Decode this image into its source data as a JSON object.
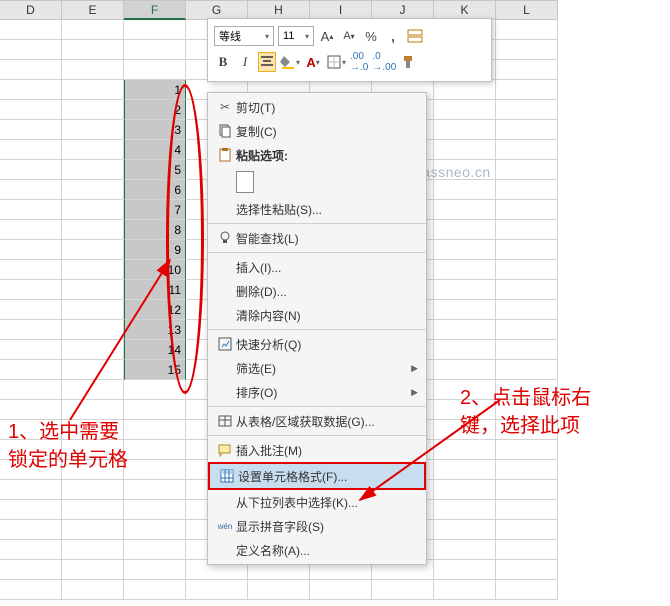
{
  "columns": [
    "D",
    "E",
    "F",
    "G",
    "H",
    "I",
    "J",
    "K",
    "L"
  ],
  "selected_column_index": 2,
  "selected_values": [
    "1",
    "2",
    "3",
    "4",
    "5",
    "6",
    "7",
    "8",
    "9",
    "10",
    "11",
    "12",
    "13",
    "14",
    "15"
  ],
  "total_rows": 29,
  "mini_toolbar": {
    "font_name": "等线",
    "font_size": "11",
    "ainc": "A",
    "adec": "A",
    "bold": "B",
    "italic": "I",
    "pct": "%",
    "comma": ","
  },
  "watermark": "passneo.cn",
  "menu": {
    "cut": "剪切(T)",
    "copy": "复制(C)",
    "paste_options": "粘贴选项:",
    "paste_special": "选择性粘贴(S)...",
    "smart_lookup": "智能查找(L)",
    "insert": "插入(I)...",
    "delete": "删除(D)...",
    "clear": "清除内容(N)",
    "quick_analysis": "快速分析(Q)",
    "filter": "筛选(E)",
    "sort": "排序(O)",
    "from_table": "从表格/区域获取数据(G)...",
    "insert_comment": "插入批注(M)",
    "format_cells": "设置单元格格式(F)...",
    "from_dropdown": "从下拉列表中选择(K)...",
    "show_phonetic": "显示拼音字段(S)",
    "define_name": "定义名称(A)...",
    "phonetic_badge": "wén"
  },
  "annotations": {
    "a1_l1": "1、选中需要",
    "a1_l2": "锁定的单元格",
    "a2_l1": "2、点击鼠标右",
    "a2_l2": "键，选择此项"
  }
}
